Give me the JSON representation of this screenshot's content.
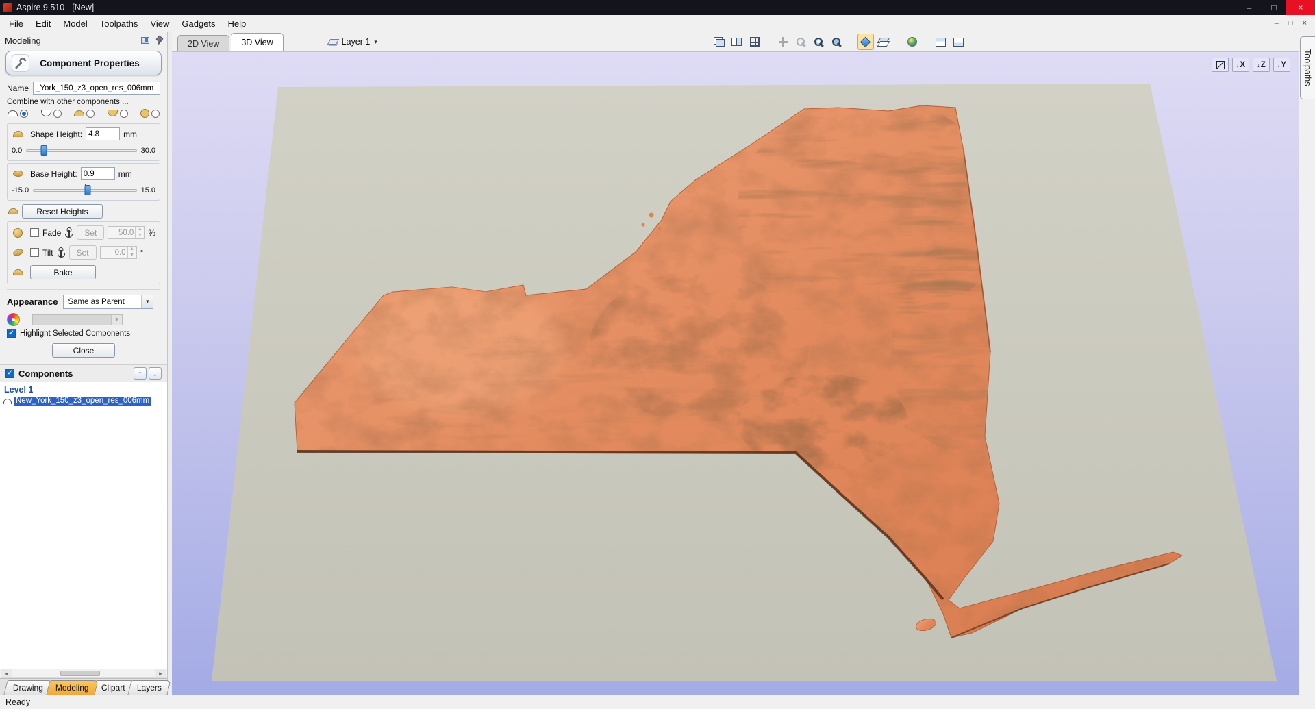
{
  "window": {
    "title": "Aspire 9.510 - [New]"
  },
  "menu": {
    "items": [
      "File",
      "Edit",
      "Model",
      "Toolpaths",
      "View",
      "Gadgets",
      "Help"
    ]
  },
  "icons": {
    "minimize": "–",
    "maximize": "□",
    "close": "×",
    "mdi_minimize": "–",
    "mdi_restore": "□",
    "mdi_close": "×",
    "dropdown": "▾",
    "check": "✓",
    "spin_up": "▲",
    "spin_down": "▼",
    "up_arrow": "↑",
    "down_arrow": "↓",
    "scroll_left": "◄",
    "scroll_right": "►",
    "view_down": "↓"
  },
  "left_panel": {
    "header": "Modeling",
    "component_properties": {
      "title": "Component Properties",
      "name_label": "Name",
      "name_value": "_York_150_z3_open_res_006mm",
      "combine_label": "Combine with other components ...",
      "combine_modes": [
        "add",
        "subtract",
        "merge-high",
        "merge-low",
        "multiply"
      ],
      "combine_selected": "add",
      "shape_height": {
        "label": "Shape Height:",
        "value": "4.8",
        "unit": "mm",
        "min": "0.0",
        "max": "30.0",
        "percent": 16
      },
      "base_height": {
        "label": "Base Height:",
        "value": "0.9",
        "unit": "mm",
        "min": "-15.0",
        "max": "15.0",
        "percent": 53
      },
      "reset_label": "Reset Heights",
      "fade_label": "Fade",
      "tilt_label": "Tilt",
      "set_label": "Set",
      "fade_value": "50.0",
      "fade_unit": "%",
      "tilt_value": "0.0",
      "tilt_unit": "°",
      "bake_label": "Bake",
      "appearance_label": "Appearance",
      "appearance_value": "Same as Parent",
      "highlight_label": "Highlight Selected Components",
      "close_label": "Close"
    },
    "components": {
      "title": "Components",
      "level_label": "Level 1",
      "item": "New_York_150_z3_open_res_006mm",
      "item_selected": true
    },
    "tabs": {
      "drawing": "Drawing",
      "modeling": "Modeling",
      "clipart": "Clipart",
      "layers": "Layers",
      "active": "Modeling"
    }
  },
  "view_area": {
    "tab_2d": "2D View",
    "tab_3d": "3D View",
    "active_tab": "3D View",
    "layer_label": "Layer 1",
    "toolbar_icon_names": [
      "tile-windows-icon",
      "split-2d3d-icon",
      "grid-snap-icon",
      "pan-icon",
      "zoom-icon",
      "zoom-box-icon",
      "zoom-extents-icon",
      "shaded-view-icon",
      "wireframe-planes-icon",
      "material-sphere-icon",
      "layout-split-icon",
      "layout-single-icon"
    ],
    "view_cube": {
      "x": "X",
      "z": "Z",
      "y": "Y"
    }
  },
  "right_tab": "Toolpaths",
  "status": "Ready",
  "colors": {
    "terrain": "#e28a5e",
    "terrain_shadow": "#58301a",
    "ground_plane": "#cac9bd",
    "sky_top": "#dedbf4",
    "sky_bottom": "#a4abe5",
    "selection_blue": "#2a62c8",
    "active_tab_orange": "#f0a93a"
  }
}
